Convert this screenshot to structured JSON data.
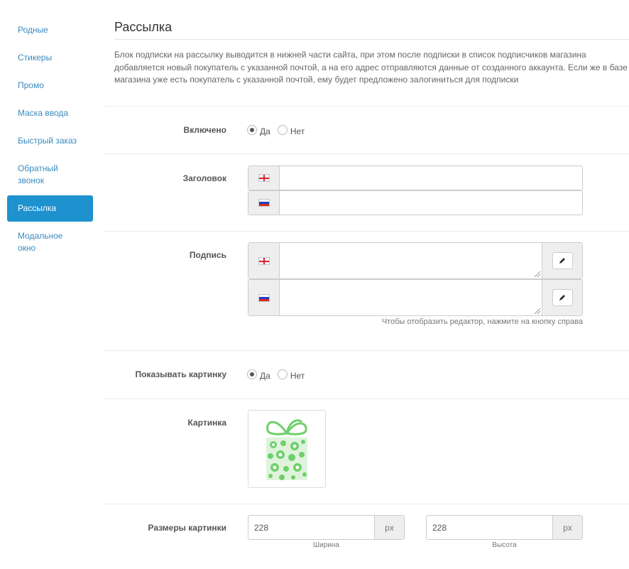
{
  "sidebar": {
    "items": [
      {
        "label": "Родные",
        "active": false
      },
      {
        "label": "Стикеры",
        "active": false
      },
      {
        "label": "Промо",
        "active": false
      },
      {
        "label": "Маска ввода",
        "active": false
      },
      {
        "label": "Быстрый заказ",
        "active": false
      },
      {
        "label": "Обратный звонок",
        "active": false
      },
      {
        "label": "Рассылка",
        "active": true
      },
      {
        "label": "Модальное окно",
        "active": false
      }
    ]
  },
  "main": {
    "title": "Рассылка",
    "description": "Блок подписки на рассылку выводится в нижней части сайта, при этом после подписки в список подписчиков магазина добавляется новый покупатель с указанной почтой, а на его адрес отправляются данные от созданного аккаунта. Если же в базе магазина уже есть покупатель с указанной почтой, ему будет предложено залогиниться для подписки"
  },
  "form": {
    "enabled": {
      "label": "Включено",
      "yes": "Да",
      "no": "Нет",
      "value": "Да"
    },
    "heading": {
      "label": "Заголовок",
      "value_en": "",
      "value_ru": ""
    },
    "caption": {
      "label": "Подпись",
      "value_en": "",
      "value_ru": "",
      "hint": "Чтобы отобразить редактор, нажмите на кнопку справа"
    },
    "show_image": {
      "label": "Показывать картинку",
      "yes": "Да",
      "no": "Нет",
      "value": "Да"
    },
    "image": {
      "label": "Картинка",
      "icon": "gift-box-image"
    },
    "image_size": {
      "label": "Размеры картинки",
      "width": "228",
      "height": "228",
      "unit": "px",
      "width_caption": "Ширина",
      "height_caption": "Высота"
    }
  },
  "colors": {
    "link": "#3a8ac0",
    "active_bg": "#1e91cf",
    "gift_green": "#6fcf6a"
  }
}
